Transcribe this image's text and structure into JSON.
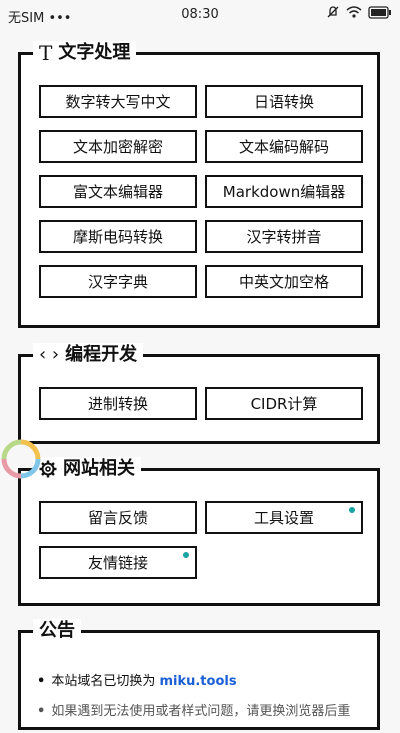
{
  "status": {
    "carrier": "无SIM",
    "dots": "•••",
    "time": "08:30"
  },
  "sections": {
    "text": {
      "title": "文字处理",
      "items": [
        "数字转大写中文",
        "日语转换",
        "文本加密解密",
        "文本编码解码",
        "富文本编辑器",
        "Markdown编辑器",
        "摩斯电码转换",
        "汉字转拼音",
        "汉字字典",
        "中英文加空格"
      ]
    },
    "dev": {
      "title": "编程开发",
      "items": [
        "进制转换",
        "CIDR计算"
      ]
    },
    "site": {
      "title": "网站相关",
      "items": [
        "留言反馈",
        "工具设置",
        "友情链接"
      ]
    },
    "notice": {
      "title": "公告",
      "item1_prefix": "本站域名已切换为",
      "item1_link": "miku.tools",
      "item2": "如果遇到无法使用或者样式问题，请更换浏览器后重"
    }
  },
  "colors": {
    "dot": "#1aa3a3",
    "link": "#1a5fd6"
  }
}
